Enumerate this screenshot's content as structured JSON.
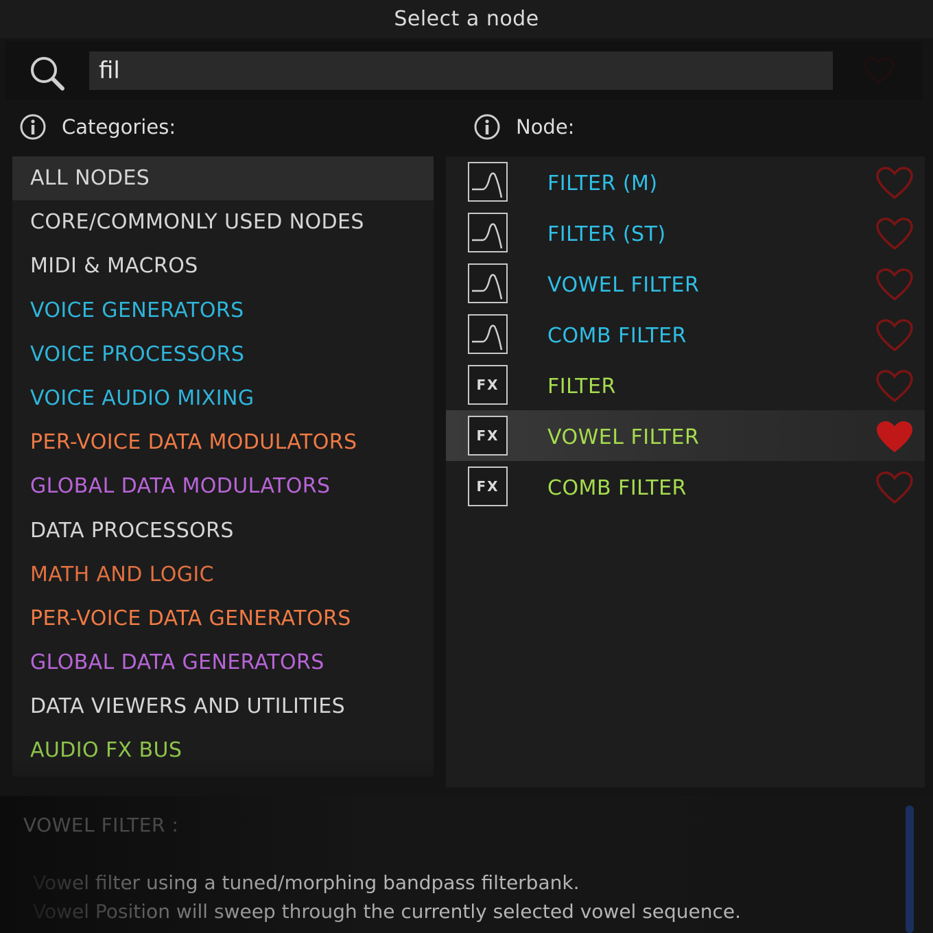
{
  "window": {
    "title": "Select a node"
  },
  "search": {
    "value": "fil"
  },
  "headers": {
    "categories": "Categories:",
    "node": "Node:"
  },
  "categories": [
    {
      "label": "ALL NODES",
      "color": "#d6d6d6",
      "selected": true
    },
    {
      "label": "CORE/COMMONLY USED NODES",
      "color": "#d6d6d6"
    },
    {
      "label": "MIDI & MACROS",
      "color": "#d6d6d6"
    },
    {
      "label": "VOICE GENERATORS",
      "color": "#2fb5db"
    },
    {
      "label": "VOICE PROCESSORS",
      "color": "#2fb5db"
    },
    {
      "label": "VOICE AUDIO MIXING",
      "color": "#2fb5db"
    },
    {
      "label": "PER-VOICE DATA MODULATORS",
      "color": "#f07a45"
    },
    {
      "label": "GLOBAL DATA MODULATORS",
      "color": "#b865d8"
    },
    {
      "label": "DATA PROCESSORS",
      "color": "#d6d6d6"
    },
    {
      "label": "MATH AND LOGIC",
      "color": "#e2703f"
    },
    {
      "label": "PER-VOICE DATA GENERATORS",
      "color": "#f07a45"
    },
    {
      "label": "GLOBAL DATA GENERATORS",
      "color": "#b865d8"
    },
    {
      "label": "DATA VIEWERS AND UTILITIES",
      "color": "#d6d6d6"
    },
    {
      "label": "AUDIO FX BUS",
      "color": "#8ec44a"
    }
  ],
  "nodes": [
    {
      "label": "FILTER (M)",
      "icon": "filter-curve-icon",
      "color": "#2fbfe6",
      "favorite": false
    },
    {
      "label": "FILTER (ST)",
      "icon": "filter-curve-icon",
      "color": "#2fbfe6",
      "favorite": false
    },
    {
      "label": "VOWEL FILTER",
      "icon": "filter-curve-icon",
      "color": "#2fbfe6",
      "favorite": false
    },
    {
      "label": "COMB FILTER",
      "icon": "filter-curve-icon",
      "color": "#2fbfe6",
      "favorite": false
    },
    {
      "label": "FILTER",
      "icon": "fx-icon",
      "fx_text": "FX",
      "color": "#a6dc4e",
      "favorite": false
    },
    {
      "label": "VOWEL FILTER",
      "icon": "fx-icon",
      "fx_text": "FX",
      "color": "#a6dc4e",
      "favorite": true,
      "selected": true
    },
    {
      "label": "COMB FILTER",
      "icon": "fx-icon",
      "fx_text": "FX",
      "color": "#a6dc4e",
      "favorite": false
    }
  ],
  "description": {
    "title": "VOWEL FILTER :",
    "lines": [
      "Vowel filter using a tuned/morphing bandpass filterbank.",
      "Vowel Position will sweep through the currently selected vowel sequence."
    ]
  },
  "colors": {
    "heart_red": "#c01818",
    "heart_outline": "#7a1414"
  }
}
